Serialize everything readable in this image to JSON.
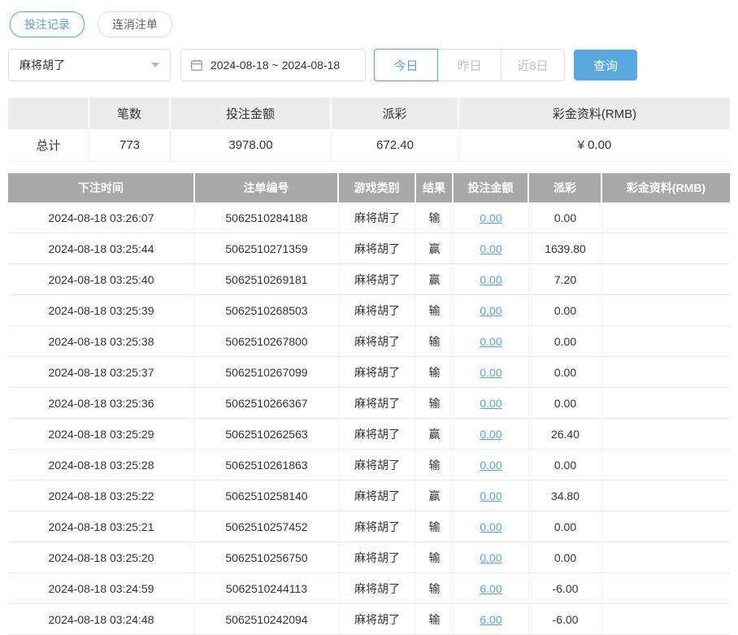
{
  "tabs": [
    {
      "label": "投注记录"
    },
    {
      "label": "连消注单"
    }
  ],
  "filters": {
    "game_select": "麻将胡了",
    "date_range": "2024-08-18 ~ 2024-08-18",
    "quick_buttons": [
      {
        "label": "今日"
      },
      {
        "label": "昨日"
      },
      {
        "label": "近8日"
      }
    ],
    "search_label": "查询"
  },
  "summary": {
    "headers": [
      "",
      "笔数",
      "投注金额",
      "派彩",
      "彩金资料(RMB)"
    ],
    "total": {
      "label": "总计",
      "count": "773",
      "bet_amount": "3978.00",
      "payout": "672.40",
      "bonus": "¥ 0.00"
    }
  },
  "table": {
    "headers": [
      "下注时间",
      "注单编号",
      "游戏类别",
      "结果",
      "投注金额",
      "派彩",
      "彩金资料(RMB)"
    ],
    "rows": [
      {
        "time": "2024-08-18 03:26:07",
        "order_id": "5062510284188",
        "game": "麻将胡了",
        "result": "输",
        "bet": "0.00",
        "payout": "0.00",
        "bonus": ""
      },
      {
        "time": "2024-08-18 03:25:44",
        "order_id": "5062510271359",
        "game": "麻将胡了",
        "result": "赢",
        "bet": "0.00",
        "payout": "1639.80",
        "bonus": ""
      },
      {
        "time": "2024-08-18 03:25:40",
        "order_id": "5062510269181",
        "game": "麻将胡了",
        "result": "赢",
        "bet": "0.00",
        "payout": "7.20",
        "bonus": ""
      },
      {
        "time": "2024-08-18 03:25:39",
        "order_id": "5062510268503",
        "game": "麻将胡了",
        "result": "输",
        "bet": "0.00",
        "payout": "0.00",
        "bonus": ""
      },
      {
        "time": "2024-08-18 03:25:38",
        "order_id": "5062510267800",
        "game": "麻将胡了",
        "result": "输",
        "bet": "0.00",
        "payout": "0.00",
        "bonus": ""
      },
      {
        "time": "2024-08-18 03:25:37",
        "order_id": "5062510267099",
        "game": "麻将胡了",
        "result": "输",
        "bet": "0.00",
        "payout": "0.00",
        "bonus": ""
      },
      {
        "time": "2024-08-18 03:25:36",
        "order_id": "5062510266367",
        "game": "麻将胡了",
        "result": "输",
        "bet": "0.00",
        "payout": "0.00",
        "bonus": ""
      },
      {
        "time": "2024-08-18 03:25:29",
        "order_id": "5062510262563",
        "game": "麻将胡了",
        "result": "赢",
        "bet": "0.00",
        "payout": "26.40",
        "bonus": ""
      },
      {
        "time": "2024-08-18 03:25:28",
        "order_id": "5062510261863",
        "game": "麻将胡了",
        "result": "输",
        "bet": "0.00",
        "payout": "0.00",
        "bonus": ""
      },
      {
        "time": "2024-08-18 03:25:22",
        "order_id": "5062510258140",
        "game": "麻将胡了",
        "result": "赢",
        "bet": "0.00",
        "payout": "34.80",
        "bonus": ""
      },
      {
        "time": "2024-08-18 03:25:21",
        "order_id": "5062510257452",
        "game": "麻将胡了",
        "result": "输",
        "bet": "0.00",
        "payout": "0.00",
        "bonus": ""
      },
      {
        "time": "2024-08-18 03:25:20",
        "order_id": "5062510256750",
        "game": "麻将胡了",
        "result": "输",
        "bet": "0.00",
        "payout": "0.00",
        "bonus": ""
      },
      {
        "time": "2024-08-18 03:24:59",
        "order_id": "5062510244113",
        "game": "麻将胡了",
        "result": "输",
        "bet": "6.00",
        "payout": "-6.00",
        "bonus": ""
      },
      {
        "time": "2024-08-18 03:24:48",
        "order_id": "5062510242094",
        "game": "麻将胡了",
        "result": "输",
        "bet": "6.00",
        "payout": "-6.00",
        "bonus": ""
      }
    ]
  },
  "colors": {
    "accent": "#54a4da",
    "button_bg": "#57a8dc",
    "table_header_bg": "#a8a8a8",
    "summary_header_bg": "#ececec",
    "negative": "#e05c5c",
    "link": "#54a4da"
  }
}
